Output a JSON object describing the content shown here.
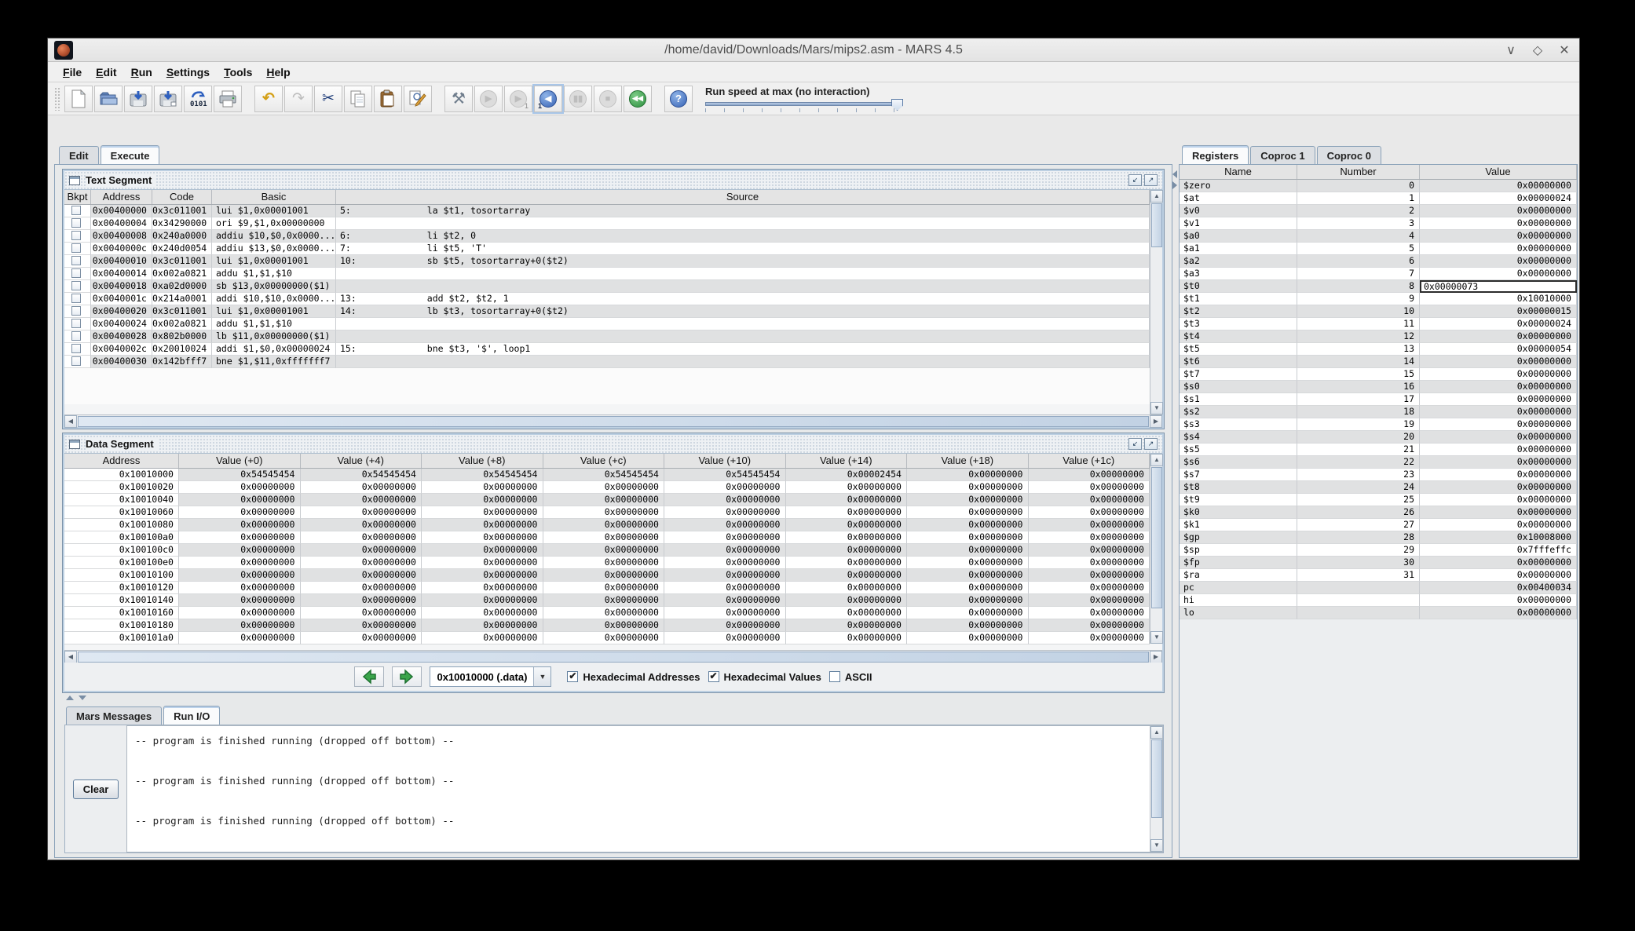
{
  "window": {
    "title": "/home/david/Downloads/Mars/mips2.asm - MARS 4.5",
    "controls": {
      "minimize": "∨",
      "maximize": "◇",
      "close": "✕"
    }
  },
  "menu": {
    "items": [
      "File",
      "Edit",
      "Run",
      "Settings",
      "Tools",
      "Help"
    ]
  },
  "toolbar": {
    "run_speed": {
      "label": "Run speed at max (no interaction)"
    },
    "buttons": [
      {
        "name": "new-file-button",
        "icon": "new-file-icon",
        "enabled": true
      },
      {
        "name": "open-file-button",
        "icon": "open-file-icon",
        "enabled": true
      },
      {
        "name": "save-button",
        "icon": "save-icon",
        "enabled": true
      },
      {
        "name": "save-as-button",
        "icon": "save-as-icon",
        "enabled": true
      },
      {
        "name": "dump-memory-button",
        "icon": "dump-memory-icon",
        "enabled": true
      },
      {
        "name": "print-button",
        "icon": "print-icon",
        "enabled": true,
        "group_end": true
      },
      {
        "name": "undo-button",
        "icon": "undo-icon",
        "glyph": "↶",
        "enabled": true
      },
      {
        "name": "redo-button",
        "icon": "redo-icon",
        "glyph": "↷",
        "enabled": false
      },
      {
        "name": "cut-button",
        "icon": "cut-icon",
        "glyph": "✂",
        "enabled": true
      },
      {
        "name": "copy-button",
        "icon": "copy-icon",
        "enabled": true
      },
      {
        "name": "paste-button",
        "icon": "paste-icon",
        "enabled": true
      },
      {
        "name": "find-replace-button",
        "icon": "find-replace-icon",
        "enabled": true,
        "group_end": true
      },
      {
        "name": "assemble-button",
        "icon": "assemble-icon",
        "glyph": "⚒",
        "enabled": true
      },
      {
        "name": "run-go-button",
        "icon": "play-icon",
        "glyph": "▶",
        "enabled": false
      },
      {
        "name": "step-forward-button",
        "icon": "step-forward-icon",
        "glyph": "▶",
        "sub": "1",
        "enabled": false
      },
      {
        "name": "step-backward-button",
        "icon": "step-backward-icon",
        "glyph": "◀",
        "sub": "1",
        "enabled": true,
        "focus": true
      },
      {
        "name": "pause-button",
        "icon": "pause-icon",
        "glyph": "▮▮",
        "enabled": false
      },
      {
        "name": "stop-button",
        "icon": "stop-icon",
        "glyph": "■",
        "enabled": false
      },
      {
        "name": "reset-button",
        "icon": "reset-icon",
        "glyph": "◀◀",
        "enabled": true,
        "group_end": true
      },
      {
        "name": "help-button",
        "icon": "help-icon",
        "glyph": "?",
        "enabled": true
      }
    ]
  },
  "main_tabs": {
    "items": [
      {
        "label": "Edit",
        "selected": false
      },
      {
        "label": "Execute",
        "selected": true
      }
    ]
  },
  "text_segment": {
    "title": "Text Segment",
    "columns": [
      "Bkpt",
      "Address",
      "Code",
      "Basic",
      "Source"
    ],
    "rows": [
      {
        "address": "0x00400000",
        "code": "0x3c011001",
        "basic": "lui $1,0x00001001",
        "source": "5:              la $t1, tosortarray"
      },
      {
        "address": "0x00400004",
        "code": "0x34290000",
        "basic": "ori $9,$1,0x00000000",
        "source": ""
      },
      {
        "address": "0x00400008",
        "code": "0x240a0000",
        "basic": "addiu $10,$0,0x0000...",
        "source": "6:              li $t2, 0"
      },
      {
        "address": "0x0040000c",
        "code": "0x240d0054",
        "basic": "addiu $13,$0,0x0000...",
        "source": "7:              li $t5, 'T'"
      },
      {
        "address": "0x00400010",
        "code": "0x3c011001",
        "basic": "lui $1,0x00001001",
        "source": "10:             sb $t5, tosortarray+0($t2)"
      },
      {
        "address": "0x00400014",
        "code": "0x002a0821",
        "basic": "addu $1,$1,$10",
        "source": ""
      },
      {
        "address": "0x00400018",
        "code": "0xa02d0000",
        "basic": "sb $13,0x00000000($1)",
        "source": ""
      },
      {
        "address": "0x0040001c",
        "code": "0x214a0001",
        "basic": "addi $10,$10,0x0000...",
        "source": "13:             add $t2, $t2, 1"
      },
      {
        "address": "0x00400020",
        "code": "0x3c011001",
        "basic": "lui $1,0x00001001",
        "source": "14:             lb $t3, tosortarray+0($t2)"
      },
      {
        "address": "0x00400024",
        "code": "0x002a0821",
        "basic": "addu $1,$1,$10",
        "source": ""
      },
      {
        "address": "0x00400028",
        "code": "0x802b0000",
        "basic": "lb $11,0x00000000($1)",
        "source": ""
      },
      {
        "address": "0x0040002c",
        "code": "0x20010024",
        "basic": "addi $1,$0,0x00000024",
        "source": "15:             bne $t3, '$', loop1"
      },
      {
        "address": "0x00400030",
        "code": "0x142bfff7",
        "basic": "bne $1,$11,0xfffffff7",
        "source": ""
      }
    ]
  },
  "data_segment": {
    "title": "Data Segment",
    "columns": [
      "Address",
      "Value (+0)",
      "Value (+4)",
      "Value (+8)",
      "Value (+c)",
      "Value (+10)",
      "Value (+14)",
      "Value (+18)",
      "Value (+1c)"
    ],
    "rows": [
      {
        "address": "0x10010000",
        "values": [
          "0x54545454",
          "0x54545454",
          "0x54545454",
          "0x54545454",
          "0x54545454",
          "0x00002454",
          "0x00000000",
          "0x00000000"
        ]
      },
      {
        "address": "0x10010020",
        "values": [
          "0x00000000",
          "0x00000000",
          "0x00000000",
          "0x00000000",
          "0x00000000",
          "0x00000000",
          "0x00000000",
          "0x00000000"
        ]
      },
      {
        "address": "0x10010040",
        "values": [
          "0x00000000",
          "0x00000000",
          "0x00000000",
          "0x00000000",
          "0x00000000",
          "0x00000000",
          "0x00000000",
          "0x00000000"
        ]
      },
      {
        "address": "0x10010060",
        "values": [
          "0x00000000",
          "0x00000000",
          "0x00000000",
          "0x00000000",
          "0x00000000",
          "0x00000000",
          "0x00000000",
          "0x00000000"
        ]
      },
      {
        "address": "0x10010080",
        "values": [
          "0x00000000",
          "0x00000000",
          "0x00000000",
          "0x00000000",
          "0x00000000",
          "0x00000000",
          "0x00000000",
          "0x00000000"
        ]
      },
      {
        "address": "0x100100a0",
        "values": [
          "0x00000000",
          "0x00000000",
          "0x00000000",
          "0x00000000",
          "0x00000000",
          "0x00000000",
          "0x00000000",
          "0x00000000"
        ]
      },
      {
        "address": "0x100100c0",
        "values": [
          "0x00000000",
          "0x00000000",
          "0x00000000",
          "0x00000000",
          "0x00000000",
          "0x00000000",
          "0x00000000",
          "0x00000000"
        ]
      },
      {
        "address": "0x100100e0",
        "values": [
          "0x00000000",
          "0x00000000",
          "0x00000000",
          "0x00000000",
          "0x00000000",
          "0x00000000",
          "0x00000000",
          "0x00000000"
        ]
      },
      {
        "address": "0x10010100",
        "values": [
          "0x00000000",
          "0x00000000",
          "0x00000000",
          "0x00000000",
          "0x00000000",
          "0x00000000",
          "0x00000000",
          "0x00000000"
        ]
      },
      {
        "address": "0x10010120",
        "values": [
          "0x00000000",
          "0x00000000",
          "0x00000000",
          "0x00000000",
          "0x00000000",
          "0x00000000",
          "0x00000000",
          "0x00000000"
        ]
      },
      {
        "address": "0x10010140",
        "values": [
          "0x00000000",
          "0x00000000",
          "0x00000000",
          "0x00000000",
          "0x00000000",
          "0x00000000",
          "0x00000000",
          "0x00000000"
        ]
      },
      {
        "address": "0x10010160",
        "values": [
          "0x00000000",
          "0x00000000",
          "0x00000000",
          "0x00000000",
          "0x00000000",
          "0x00000000",
          "0x00000000",
          "0x00000000"
        ]
      },
      {
        "address": "0x10010180",
        "values": [
          "0x00000000",
          "0x00000000",
          "0x00000000",
          "0x00000000",
          "0x00000000",
          "0x00000000",
          "0x00000000",
          "0x00000000"
        ]
      },
      {
        "address": "0x100101a0",
        "values": [
          "0x00000000",
          "0x00000000",
          "0x00000000",
          "0x00000000",
          "0x00000000",
          "0x00000000",
          "0x00000000",
          "0x00000000"
        ]
      }
    ],
    "controls": {
      "combo_value": "0x10010000 (.data)",
      "checkboxes": [
        {
          "label": "Hexadecimal Addresses",
          "checked": true
        },
        {
          "label": "Hexadecimal Values",
          "checked": true
        },
        {
          "label": "ASCII",
          "checked": false
        }
      ]
    }
  },
  "messages": {
    "tabs": {
      "items": [
        {
          "label": "Mars Messages",
          "selected": false
        },
        {
          "label": "Run I/O",
          "selected": true
        }
      ]
    },
    "clear_label": "Clear",
    "lines": [
      "-- program is finished running (dropped off bottom) --",
      "-- program is finished running (dropped off bottom) --",
      "-- program is finished running (dropped off bottom) --"
    ]
  },
  "registers": {
    "tabs": {
      "items": [
        {
          "label": "Registers",
          "selected": true
        },
        {
          "label": "Coproc 1",
          "selected": false
        },
        {
          "label": "Coproc 0",
          "selected": false
        }
      ]
    },
    "columns": [
      "Name",
      "Number",
      "Value"
    ],
    "editing_register": "$t0",
    "editing_value": "0x00000073",
    "rows": [
      {
        "name": "$zero",
        "number": "0",
        "value": "0x00000000"
      },
      {
        "name": "$at",
        "number": "1",
        "value": "0x00000024"
      },
      {
        "name": "$v0",
        "number": "2",
        "value": "0x00000000"
      },
      {
        "name": "$v1",
        "number": "3",
        "value": "0x00000000"
      },
      {
        "name": "$a0",
        "number": "4",
        "value": "0x00000000"
      },
      {
        "name": "$a1",
        "number": "5",
        "value": "0x00000000"
      },
      {
        "name": "$a2",
        "number": "6",
        "value": "0x00000000"
      },
      {
        "name": "$a3",
        "number": "7",
        "value": "0x00000000"
      },
      {
        "name": "$t0",
        "number": "8",
        "value": "0x00000073"
      },
      {
        "name": "$t1",
        "number": "9",
        "value": "0x10010000"
      },
      {
        "name": "$t2",
        "number": "10",
        "value": "0x00000015"
      },
      {
        "name": "$t3",
        "number": "11",
        "value": "0x00000024"
      },
      {
        "name": "$t4",
        "number": "12",
        "value": "0x00000000"
      },
      {
        "name": "$t5",
        "number": "13",
        "value": "0x00000054"
      },
      {
        "name": "$t6",
        "number": "14",
        "value": "0x00000000"
      },
      {
        "name": "$t7",
        "number": "15",
        "value": "0x00000000"
      },
      {
        "name": "$s0",
        "number": "16",
        "value": "0x00000000"
      },
      {
        "name": "$s1",
        "number": "17",
        "value": "0x00000000"
      },
      {
        "name": "$s2",
        "number": "18",
        "value": "0x00000000"
      },
      {
        "name": "$s3",
        "number": "19",
        "value": "0x00000000"
      },
      {
        "name": "$s4",
        "number": "20",
        "value": "0x00000000"
      },
      {
        "name": "$s5",
        "number": "21",
        "value": "0x00000000"
      },
      {
        "name": "$s6",
        "number": "22",
        "value": "0x00000000"
      },
      {
        "name": "$s7",
        "number": "23",
        "value": "0x00000000"
      },
      {
        "name": "$t8",
        "number": "24",
        "value": "0x00000000"
      },
      {
        "name": "$t9",
        "number": "25",
        "value": "0x00000000"
      },
      {
        "name": "$k0",
        "number": "26",
        "value": "0x00000000"
      },
      {
        "name": "$k1",
        "number": "27",
        "value": "0x00000000"
      },
      {
        "name": "$gp",
        "number": "28",
        "value": "0x10008000"
      },
      {
        "name": "$sp",
        "number": "29",
        "value": "0x7fffeffc"
      },
      {
        "name": "$fp",
        "number": "30",
        "value": "0x00000000"
      },
      {
        "name": "$ra",
        "number": "31",
        "value": "0x00000000"
      },
      {
        "name": "pc",
        "number": "",
        "value": "0x00400034"
      },
      {
        "name": "hi",
        "number": "",
        "value": "0x00000000"
      },
      {
        "name": "lo",
        "number": "",
        "value": "0x00000000"
      }
    ]
  },
  "frame_buttons": {
    "restore_glyph": "↙",
    "maximize_glyph": "↗"
  },
  "colors": {
    "accent_blue": "#3763b5",
    "accent_green": "#2e9040",
    "row_gray": "#e0e1e2",
    "frame_border": "#7e94aa"
  }
}
